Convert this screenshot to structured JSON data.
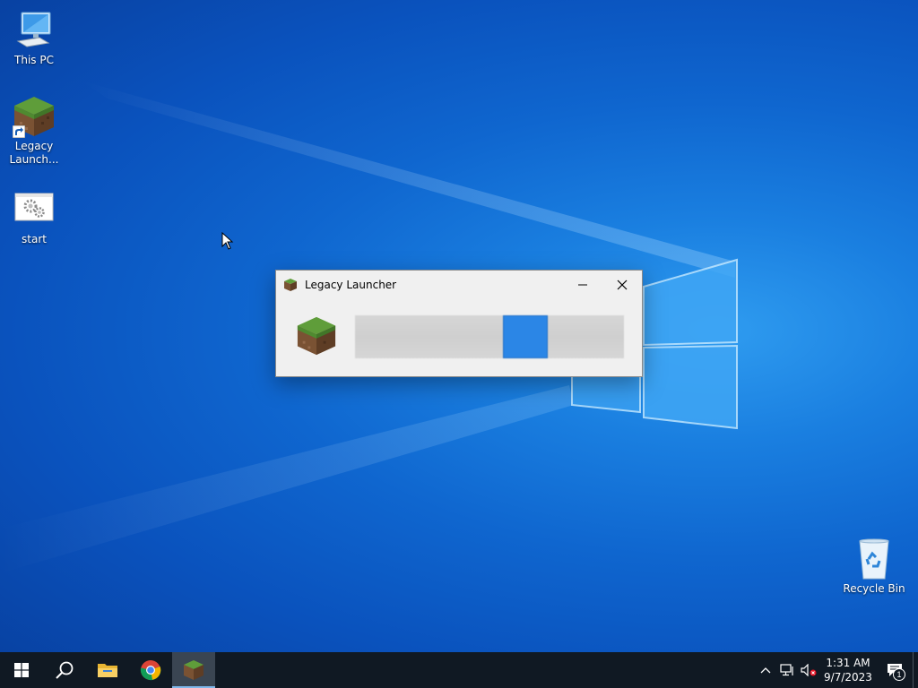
{
  "desktop": {
    "icons": [
      {
        "label": "This PC",
        "icon": "computer-icon"
      },
      {
        "label": "Legacy Launch...",
        "icon": "grass-block-icon"
      },
      {
        "label": "start",
        "icon": "gears-icon"
      },
      {
        "label": "Recycle Bin",
        "icon": "recycle-bin-icon"
      }
    ]
  },
  "window": {
    "title": "Legacy Launcher",
    "progress": {
      "state": "indeterminate",
      "chunk_position": 0.55
    },
    "colors": {
      "chunk": "#2b86e6",
      "track": "#d4d4d4"
    }
  },
  "taskbar": {
    "buttons": [
      {
        "name": "start",
        "icon": "windows-logo-icon"
      },
      {
        "name": "search",
        "icon": "search-icon"
      },
      {
        "name": "file-explorer",
        "icon": "folder-icon"
      },
      {
        "name": "chrome",
        "icon": "chrome-icon"
      },
      {
        "name": "legacy-launcher",
        "icon": "grass-block-icon",
        "active": true
      }
    ],
    "tray": {
      "time": "1:31 AM",
      "date": "9/7/2023",
      "notification_count": "1"
    }
  },
  "colors": {
    "taskbar": "#101923",
    "accent": "#0f66cf"
  }
}
